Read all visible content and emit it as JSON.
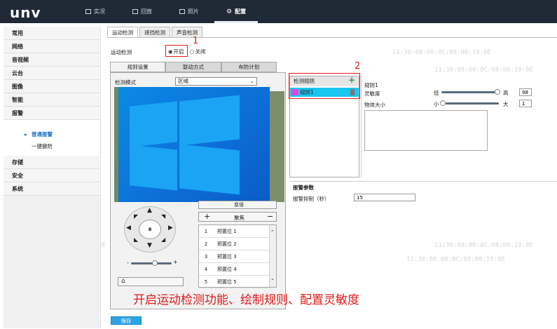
{
  "app": {
    "logo": "unv"
  },
  "nav": [
    {
      "label": "实况",
      "icon": "monitor-icon"
    },
    {
      "label": "回放",
      "icon": "film-icon"
    },
    {
      "label": "照片",
      "icon": "photo-icon"
    },
    {
      "label": "配置",
      "icon": "gear-icon"
    }
  ],
  "watermark": "11:38:08:00:0C:08:00:19:8E",
  "sidebar": {
    "items": [
      "常用",
      "网络",
      "音视频",
      "云台",
      "图像",
      "智能",
      "报警"
    ],
    "sub": [
      "普通报警",
      "一键撤防"
    ],
    "items2": [
      "存储",
      "安全",
      "系统"
    ]
  },
  "tabs": [
    "运动检测",
    "遮挡检测",
    "声音检测"
  ],
  "motion": {
    "label": "运动检测",
    "on": "开启",
    "off": "关闭"
  },
  "subtabs": [
    "规则设置",
    "联动方式",
    "布防计划"
  ],
  "rule": {
    "mode_label": "检测模式",
    "mode_value": "区域"
  },
  "ptz": {
    "zoom_label": "变倍",
    "focus_label": "聚焦"
  },
  "presets": [
    [
      "1",
      "预置位 1"
    ],
    [
      "2",
      "预置位 2"
    ],
    [
      "3",
      "预置位 3"
    ],
    [
      "4",
      "预置位 4"
    ],
    [
      "5",
      "预置位 5"
    ]
  ],
  "rules": {
    "header": "检测规则",
    "item": "规则1"
  },
  "detail": {
    "title": "规则1",
    "sens_label": "灵敏度",
    "low": "低",
    "high": "高",
    "sens_value": "98",
    "size_label": "物体大小",
    "small": "小",
    "big": "大",
    "size_value": "1"
  },
  "alarm": {
    "title": "报警参数",
    "suppress_label": "报警抑制（秒）",
    "suppress_value": "15"
  },
  "annotations": {
    "n1": "1",
    "n2": "2",
    "caption": "开启运动检测功能、绘制规则、配置灵敏度"
  },
  "save_label": "保存"
}
